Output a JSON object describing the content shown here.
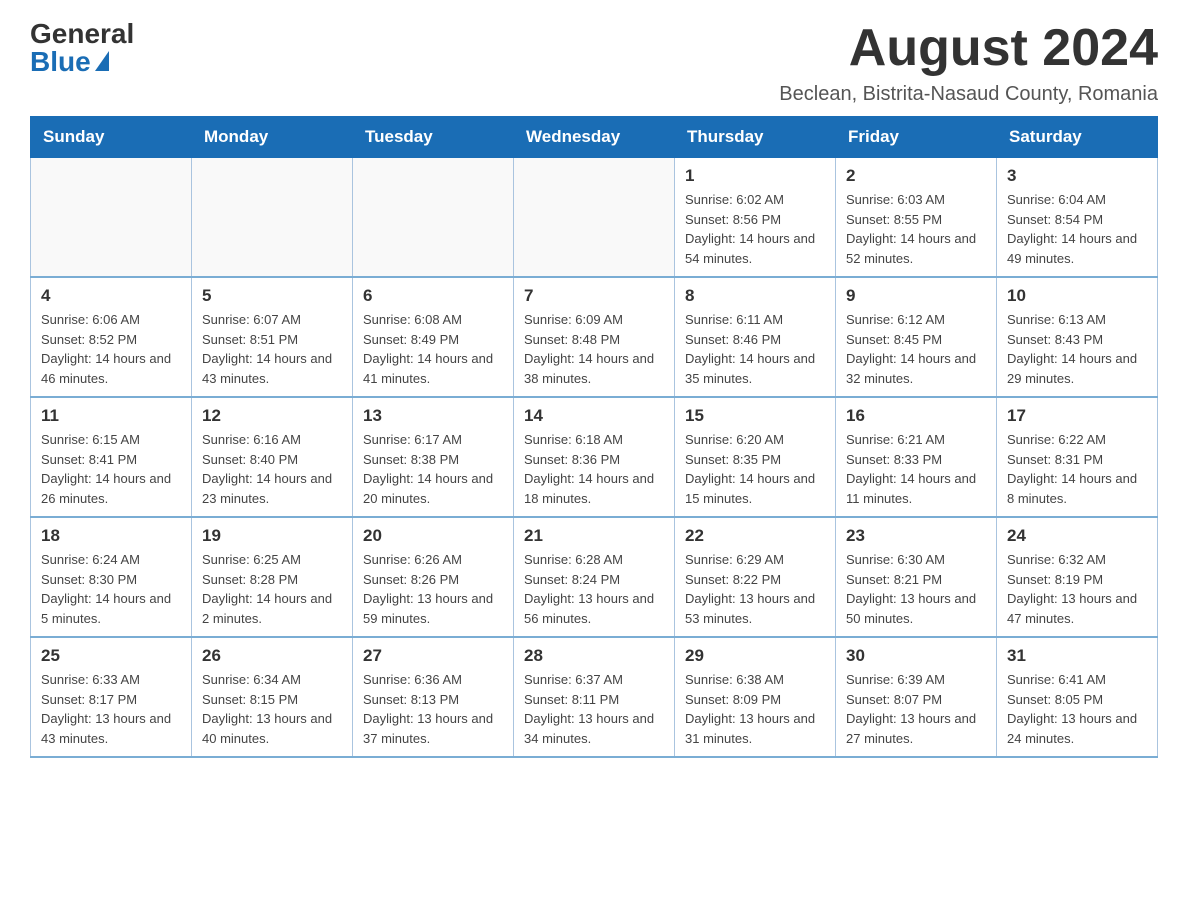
{
  "logo": {
    "general": "General",
    "blue": "Blue"
  },
  "title": "August 2024",
  "location": "Beclean, Bistrita-Nasaud County, Romania",
  "days_of_week": [
    "Sunday",
    "Monday",
    "Tuesday",
    "Wednesday",
    "Thursday",
    "Friday",
    "Saturday"
  ],
  "weeks": [
    [
      {
        "day": "",
        "info": ""
      },
      {
        "day": "",
        "info": ""
      },
      {
        "day": "",
        "info": ""
      },
      {
        "day": "",
        "info": ""
      },
      {
        "day": "1",
        "info": "Sunrise: 6:02 AM\nSunset: 8:56 PM\nDaylight: 14 hours and 54 minutes."
      },
      {
        "day": "2",
        "info": "Sunrise: 6:03 AM\nSunset: 8:55 PM\nDaylight: 14 hours and 52 minutes."
      },
      {
        "day": "3",
        "info": "Sunrise: 6:04 AM\nSunset: 8:54 PM\nDaylight: 14 hours and 49 minutes."
      }
    ],
    [
      {
        "day": "4",
        "info": "Sunrise: 6:06 AM\nSunset: 8:52 PM\nDaylight: 14 hours and 46 minutes."
      },
      {
        "day": "5",
        "info": "Sunrise: 6:07 AM\nSunset: 8:51 PM\nDaylight: 14 hours and 43 minutes."
      },
      {
        "day": "6",
        "info": "Sunrise: 6:08 AM\nSunset: 8:49 PM\nDaylight: 14 hours and 41 minutes."
      },
      {
        "day": "7",
        "info": "Sunrise: 6:09 AM\nSunset: 8:48 PM\nDaylight: 14 hours and 38 minutes."
      },
      {
        "day": "8",
        "info": "Sunrise: 6:11 AM\nSunset: 8:46 PM\nDaylight: 14 hours and 35 minutes."
      },
      {
        "day": "9",
        "info": "Sunrise: 6:12 AM\nSunset: 8:45 PM\nDaylight: 14 hours and 32 minutes."
      },
      {
        "day": "10",
        "info": "Sunrise: 6:13 AM\nSunset: 8:43 PM\nDaylight: 14 hours and 29 minutes."
      }
    ],
    [
      {
        "day": "11",
        "info": "Sunrise: 6:15 AM\nSunset: 8:41 PM\nDaylight: 14 hours and 26 minutes."
      },
      {
        "day": "12",
        "info": "Sunrise: 6:16 AM\nSunset: 8:40 PM\nDaylight: 14 hours and 23 minutes."
      },
      {
        "day": "13",
        "info": "Sunrise: 6:17 AM\nSunset: 8:38 PM\nDaylight: 14 hours and 20 minutes."
      },
      {
        "day": "14",
        "info": "Sunrise: 6:18 AM\nSunset: 8:36 PM\nDaylight: 14 hours and 18 minutes."
      },
      {
        "day": "15",
        "info": "Sunrise: 6:20 AM\nSunset: 8:35 PM\nDaylight: 14 hours and 15 minutes."
      },
      {
        "day": "16",
        "info": "Sunrise: 6:21 AM\nSunset: 8:33 PM\nDaylight: 14 hours and 11 minutes."
      },
      {
        "day": "17",
        "info": "Sunrise: 6:22 AM\nSunset: 8:31 PM\nDaylight: 14 hours and 8 minutes."
      }
    ],
    [
      {
        "day": "18",
        "info": "Sunrise: 6:24 AM\nSunset: 8:30 PM\nDaylight: 14 hours and 5 minutes."
      },
      {
        "day": "19",
        "info": "Sunrise: 6:25 AM\nSunset: 8:28 PM\nDaylight: 14 hours and 2 minutes."
      },
      {
        "day": "20",
        "info": "Sunrise: 6:26 AM\nSunset: 8:26 PM\nDaylight: 13 hours and 59 minutes."
      },
      {
        "day": "21",
        "info": "Sunrise: 6:28 AM\nSunset: 8:24 PM\nDaylight: 13 hours and 56 minutes."
      },
      {
        "day": "22",
        "info": "Sunrise: 6:29 AM\nSunset: 8:22 PM\nDaylight: 13 hours and 53 minutes."
      },
      {
        "day": "23",
        "info": "Sunrise: 6:30 AM\nSunset: 8:21 PM\nDaylight: 13 hours and 50 minutes."
      },
      {
        "day": "24",
        "info": "Sunrise: 6:32 AM\nSunset: 8:19 PM\nDaylight: 13 hours and 47 minutes."
      }
    ],
    [
      {
        "day": "25",
        "info": "Sunrise: 6:33 AM\nSunset: 8:17 PM\nDaylight: 13 hours and 43 minutes."
      },
      {
        "day": "26",
        "info": "Sunrise: 6:34 AM\nSunset: 8:15 PM\nDaylight: 13 hours and 40 minutes."
      },
      {
        "day": "27",
        "info": "Sunrise: 6:36 AM\nSunset: 8:13 PM\nDaylight: 13 hours and 37 minutes."
      },
      {
        "day": "28",
        "info": "Sunrise: 6:37 AM\nSunset: 8:11 PM\nDaylight: 13 hours and 34 minutes."
      },
      {
        "day": "29",
        "info": "Sunrise: 6:38 AM\nSunset: 8:09 PM\nDaylight: 13 hours and 31 minutes."
      },
      {
        "day": "30",
        "info": "Sunrise: 6:39 AM\nSunset: 8:07 PM\nDaylight: 13 hours and 27 minutes."
      },
      {
        "day": "31",
        "info": "Sunrise: 6:41 AM\nSunset: 8:05 PM\nDaylight: 13 hours and 24 minutes."
      }
    ]
  ]
}
